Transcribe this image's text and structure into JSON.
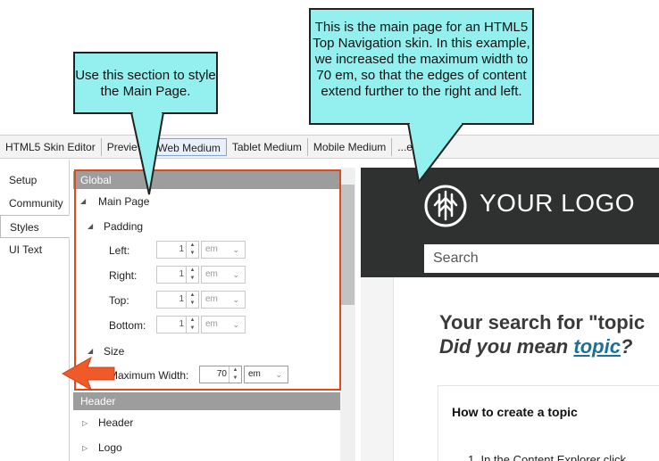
{
  "callouts": {
    "left": "Use this section to style the Main Page.",
    "right": "This is the main page for an HTML5 Top Navigation skin. In this example, we increased the maximum width to 70 em, so that the edges of content extend further to the right and left."
  },
  "tabs": [
    "HTML5 Skin Editor",
    "Preview",
    "Web Medium",
    "Tablet Medium",
    "Mobile Medium",
    "...ent"
  ],
  "active_tab": "Web Medium",
  "sidebar": {
    "items": [
      {
        "label": "Setup"
      },
      {
        "label": "Community"
      },
      {
        "label": "Styles"
      },
      {
        "label": "UI Text"
      }
    ]
  },
  "styles_panel": {
    "global_header": "Global",
    "main_page": "Main Page",
    "padding": "Padding",
    "left_label": "Left:",
    "right_label": "Right:",
    "top_label": "Top:",
    "bottom_label": "Bottom:",
    "left_value": "1",
    "right_value": "1",
    "top_value": "1",
    "bottom_value": "1",
    "unit_faded": "em",
    "size": "Size",
    "max_width_label": "Maximum Width:",
    "max_width_value": "70",
    "max_width_unit": "em",
    "header_section": "Header",
    "header_item": "Header",
    "logo_item": "Logo"
  },
  "preview": {
    "logo_text": "YOUR LOGO",
    "search_placeholder": "Search",
    "result_line": "Your search for \"topic",
    "did_you_mean": "Did you mean",
    "did_you_mean_link": "topic",
    "did_you_mean_end": "?",
    "card_title": "How to create a topic",
    "card_item": "1.  In the Content Explorer click"
  },
  "colors": {
    "callout_fill": "#94efef",
    "highlight_border": "#e04a1a",
    "arrow_orange": "#f05a28",
    "preview_header": "#2f3030",
    "link": "#1d6f96"
  }
}
